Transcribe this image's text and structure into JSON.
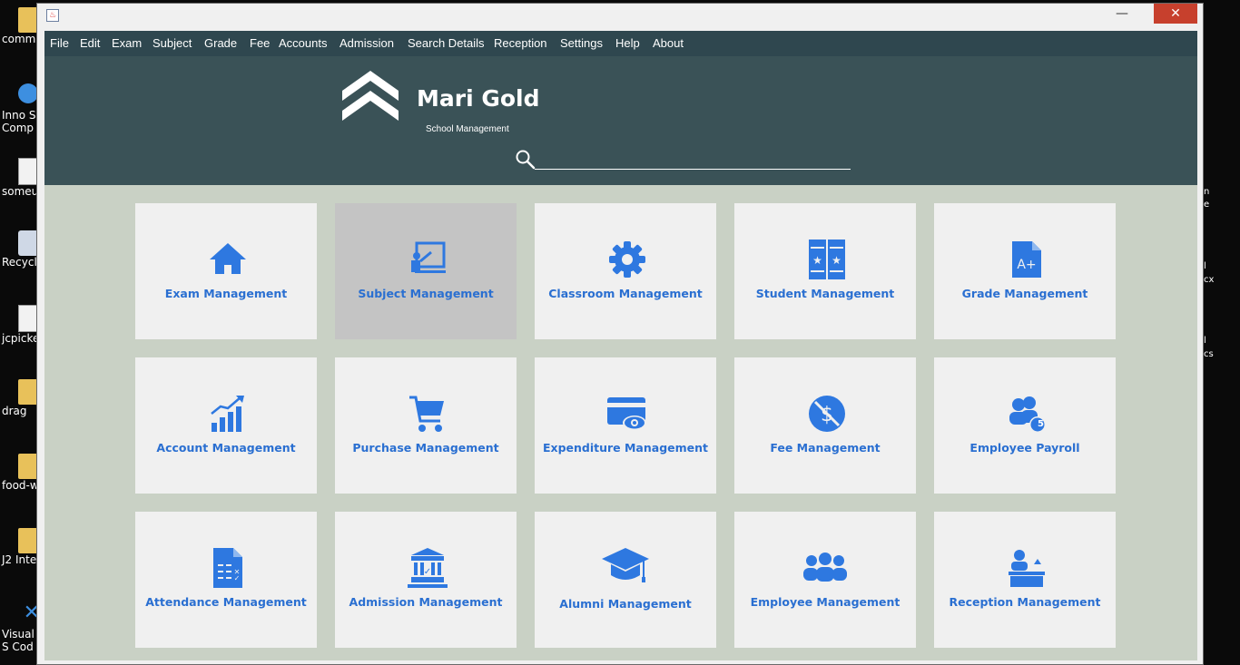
{
  "desktop": {
    "left_icons": [
      {
        "label": "comm",
        "type": "folder"
      },
      {
        "label": "Inno S Comp",
        "type": "app"
      },
      {
        "label": "someur",
        "type": "doc"
      },
      {
        "label": "Recycl",
        "type": "recycle"
      },
      {
        "label": "jcpicke",
        "type": "doc"
      },
      {
        "label": "drag",
        "type": "folder"
      },
      {
        "label": "food-w",
        "type": "folder"
      },
      {
        "label": "J2 Inte",
        "type": "folder"
      },
      {
        "label": "Visual S Cod",
        "type": "app"
      }
    ],
    "right_fragments": [
      "n",
      "e",
      "l",
      "cx",
      "l",
      "cs"
    ]
  },
  "window": {
    "title": "",
    "controls": {
      "minimize": "—",
      "maximize": "☐",
      "close": "✕"
    }
  },
  "menu": [
    "File",
    "Edit",
    "Exam",
    "Subject",
    "Grade",
    "Fee",
    "Accounts",
    "Admission",
    "Search Details",
    "Reception",
    "Settings",
    "Help",
    "About"
  ],
  "header": {
    "brand": "Mari Gold",
    "tagline": "School Management",
    "search": {
      "value": "",
      "placeholder": ""
    }
  },
  "modules": [
    {
      "label": "Exam Management",
      "icon": "home-icon",
      "selected": false
    },
    {
      "label": "Subject Management",
      "icon": "teacher-board-icon",
      "selected": true
    },
    {
      "label": "Classroom Management",
      "icon": "gear-icon",
      "selected": false
    },
    {
      "label": "Student Management",
      "icon": "lockers-icon",
      "selected": false
    },
    {
      "label": "Grade Management",
      "icon": "grade-document-icon",
      "selected": false
    },
    {
      "label": "Account Management",
      "icon": "growth-chart-icon",
      "selected": false
    },
    {
      "label": "Purchase Management",
      "icon": "shopping-cart-icon",
      "selected": false
    },
    {
      "label": "Expenditure Management",
      "icon": "card-eye-icon",
      "selected": false
    },
    {
      "label": "Fee Management",
      "icon": "no-money-icon",
      "selected": false
    },
    {
      "label": "Employee Payroll",
      "icon": "people-badge-icon",
      "selected": false,
      "badge": "5"
    },
    {
      "label": "Attendance Management",
      "icon": "checklist-icon",
      "selected": false
    },
    {
      "label": "Admission Management",
      "icon": "building-icon",
      "selected": false
    },
    {
      "label": "Alumni Management",
      "icon": "graduation-cap-icon",
      "selected": false
    },
    {
      "label": "Employee Management",
      "icon": "group-icon",
      "selected": false
    },
    {
      "label": "Reception Management",
      "icon": "reception-desk-icon",
      "selected": false
    }
  ],
  "colors": {
    "menubar": "#2f474f",
    "header": "#3a5257",
    "content_bg": "#c9d1c5",
    "tile": "#f0f0f0",
    "tile_selected": "#c4c4c4",
    "accent": "#2e78e0"
  }
}
